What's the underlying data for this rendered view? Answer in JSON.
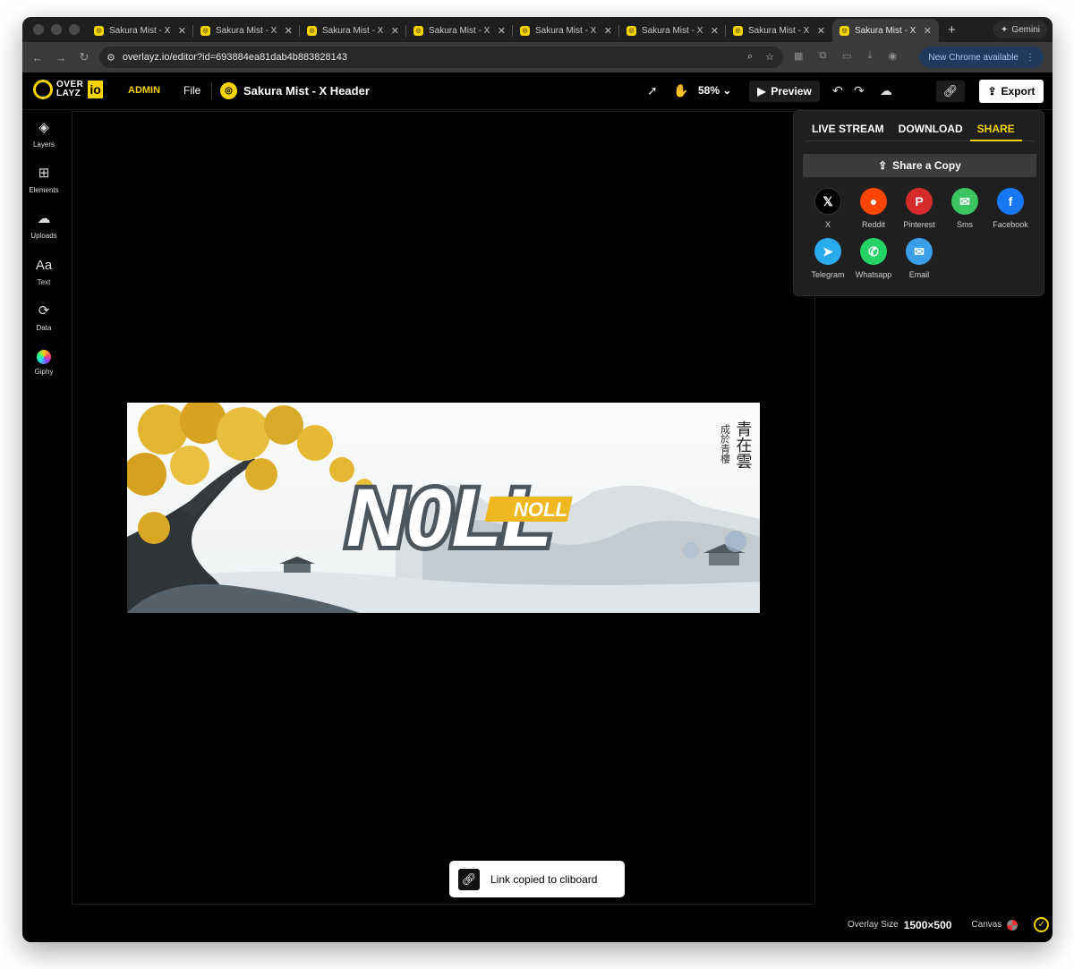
{
  "browser": {
    "tabs": [
      {
        "title": "Sakura Mist - X"
      },
      {
        "title": "Sakura Mist - X"
      },
      {
        "title": "Sakura Mist - X"
      },
      {
        "title": "Sakura Mist - X"
      },
      {
        "title": "Sakura Mist - X"
      },
      {
        "title": "Sakura Mist - X"
      },
      {
        "title": "Sakura Mist - X"
      },
      {
        "title": "Sakura Mist - X"
      }
    ],
    "gemini_label": "Gemini",
    "url": "overlayz.io/editor?id=693884ea81dab4b883828143",
    "new_chrome_label": "New Chrome available"
  },
  "app": {
    "logo_top": "OVER",
    "logo_bottom": "LAYZ",
    "logo_io": "io",
    "role_badge": "ADMIN",
    "file_menu": "File",
    "doc_title": "Sakura Mist - X Header",
    "zoom": "58%",
    "preview_label": "Preview",
    "export_label": "Export"
  },
  "sidebar": {
    "items": [
      {
        "label": "Layers",
        "icon": "layers-icon"
      },
      {
        "label": "Elements",
        "icon": "elements-icon"
      },
      {
        "label": "Uploads",
        "icon": "upload-cloud-icon"
      },
      {
        "label": "Text",
        "icon": "text-icon"
      },
      {
        "label": "Data",
        "icon": "data-icon"
      },
      {
        "label": "Giphy",
        "icon": "giphy-icon"
      }
    ]
  },
  "share_panel": {
    "tabs": [
      "LIVE STREAM",
      "DOWNLOAD",
      "SHARE"
    ],
    "active_tab": "SHARE",
    "share_copy_label": "Share a Copy",
    "targets": [
      {
        "label": "X",
        "glyph": "𝕏",
        "color": "#000000"
      },
      {
        "label": "Reddit",
        "glyph": "●",
        "color": "#ff4500"
      },
      {
        "label": "Pinterest",
        "glyph": "P",
        "color": "#e60023"
      },
      {
        "label": "Sms",
        "glyph": "✉",
        "color": "#34c759"
      },
      {
        "label": "Facebook",
        "glyph": "f",
        "color": "#1877f2"
      },
      {
        "label": "Telegram",
        "glyph": "➤",
        "color": "#2aabee"
      },
      {
        "label": "Whatsapp",
        "glyph": "✆",
        "color": "#25d366"
      },
      {
        "label": "Email",
        "glyph": "✉",
        "color": "#3a9ee8"
      }
    ]
  },
  "canvas": {
    "banner_logo": "N0LL",
    "banner_sublogo": "NOLL",
    "banner_calligraphy_main": "青在雲",
    "banner_calligraphy_side": "成於青樓"
  },
  "toast": {
    "message": "Link copied to cliboard"
  },
  "footer": {
    "overlay_size_label": "Overlay Size",
    "overlay_size_value": "1500×500",
    "canvas_label": "Canvas"
  },
  "colors": {
    "brand_yellow": "#f5d400",
    "panel_bg": "#1f1f1f"
  }
}
